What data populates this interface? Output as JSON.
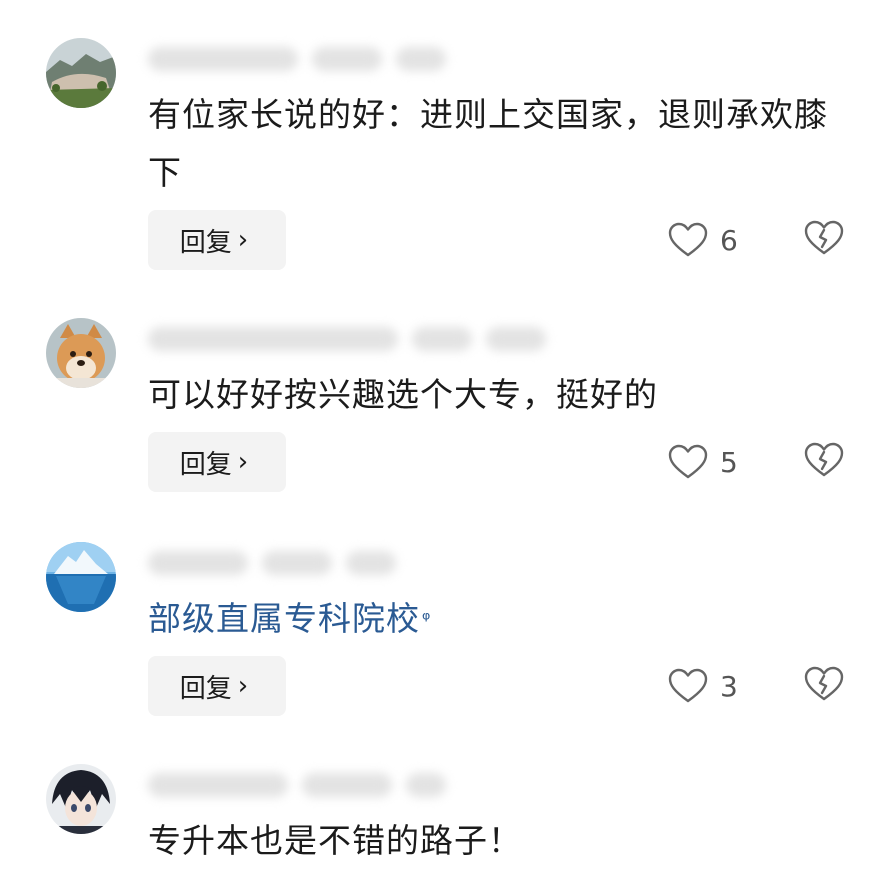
{
  "comments": [
    {
      "avatar_icon": "landscape-avatar-icon",
      "text": "有位家长说的好：进则上交国家，退则承欢膝下",
      "reply_label": "回复",
      "likes": "6"
    },
    {
      "avatar_icon": "shiba-dog-avatar-icon",
      "text": "可以好好按兴趣选个大专，挺好的",
      "reply_label": "回复",
      "likes": "5"
    },
    {
      "avatar_icon": "iceberg-avatar-icon",
      "text": "部级直属专科院校",
      "text_style": "link",
      "reply_label": "回复",
      "likes": "3"
    },
    {
      "avatar_icon": "anime-boy-avatar-icon",
      "text": "专升本也是不错的路子！"
    }
  ],
  "icons": {
    "reply_chevron": "chevron-right-icon",
    "like": "heart-icon",
    "dislike": "broken-heart-icon",
    "link_search": "search-icon"
  },
  "colors": {
    "link_text": "#2a5a93",
    "reply_bg": "#f3f3f3",
    "icon_stroke": "#666666"
  }
}
